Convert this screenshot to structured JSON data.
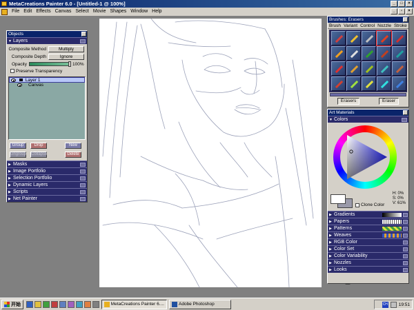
{
  "window": {
    "title": "MetaCreations Painter 6.0 - [Untitled-1 @ 100%]"
  },
  "menu": [
    "File",
    "Edit",
    "Effects",
    "Canvas",
    "Select",
    "Movie",
    "Shapes",
    "Window",
    "Help"
  ],
  "objects": {
    "title": "Objects",
    "layers_header": "Layers",
    "composite_method_label": "Composite Method",
    "composite_method_value": "Multiply",
    "composite_depth_label": "Composite Depth",
    "composite_depth_value": "Ignore",
    "opacity_label": "Opacity",
    "opacity_value": "100%",
    "opacity_fraction": 1.0,
    "preserve_transparency": "Preserve Transparency",
    "layers": [
      {
        "name": "Layer 1",
        "selected": true
      },
      {
        "name": "Canvas",
        "selected": false
      }
    ],
    "buttons": {
      "group": "Group",
      "drop": "Drop",
      "new": "New",
      "ungroup": "Ungroup",
      "collapse": "Collapse",
      "delete": "Delete"
    },
    "sections": [
      "Masks",
      "Image Portfolio",
      "Selection Portfolio",
      "Dynamic Layers",
      "Scripts",
      "Net Painter"
    ]
  },
  "brushes": {
    "title": "Brushes: Erasers",
    "tabs": [
      "Brush",
      "Variant",
      "Control",
      "Nozzle",
      "Stroke"
    ],
    "brush_name": "Erasers",
    "variant_name": "Eraser",
    "icons": [
      {
        "name": "pencil-brush-icon",
        "color": "#d04040"
      },
      {
        "name": "chalk-brush-icon",
        "color": "#f0c030"
      },
      {
        "name": "charcoal-brush-icon",
        "color": "#c0c0c0"
      },
      {
        "name": "eraser-brush-icon",
        "color": "#e04020"
      },
      {
        "name": "felt-pen-brush-icon",
        "color": "#d03030"
      },
      {
        "name": "airbrush-icon",
        "color": "#f0a020"
      },
      {
        "name": "image-hose-icon",
        "color": "#e0e0e0"
      },
      {
        "name": "crayon-brush-icon",
        "color": "#30a030"
      },
      {
        "name": "liquid-brush-icon",
        "color": "#c04020"
      },
      {
        "name": "oil-brush-icon",
        "color": "#20a0a0"
      },
      {
        "name": "watercolor-brush-icon",
        "color": "#e03030"
      },
      {
        "name": "pastel-brush-icon",
        "color": "#e0a030"
      },
      {
        "name": "cloner-brush-icon",
        "color": "#a0c020"
      },
      {
        "name": "artist-brush-icon",
        "color": "#40c0c0"
      },
      {
        "name": "plug-in-brush-icon",
        "color": "#c06040"
      },
      {
        "name": "pen-brush-icon",
        "color": "#d04030"
      },
      {
        "name": "dodge-brush-icon",
        "color": "#a0e040"
      },
      {
        "name": "burn-brush-icon",
        "color": "#e0e040"
      },
      {
        "name": "impasto-brush-icon",
        "color": "#30e0e0"
      },
      {
        "name": "wet-brush-icon",
        "color": "#4080e0"
      }
    ]
  },
  "artmat": {
    "title": "Art Materials",
    "colors_header": "Colors",
    "hsv": {
      "h": "H:  0%",
      "s": "S:  0%",
      "v": "V: 61%"
    },
    "clone_color": "Clone Color",
    "sections": [
      {
        "label": "Gradients",
        "preview": "gradient"
      },
      {
        "label": "Papers",
        "preview": "paper"
      },
      {
        "label": "Patterns",
        "preview": "pattern"
      },
      {
        "label": "Weaves",
        "preview": "weave"
      },
      {
        "label": "RGB Color",
        "preview": ""
      },
      {
        "label": "Color Set",
        "preview": ""
      },
      {
        "label": "Color Variability",
        "preview": ""
      },
      {
        "label": "Nozzles",
        "preview": ""
      },
      {
        "label": "Looks",
        "preview": ""
      }
    ]
  },
  "taskbar": {
    "start": "开始",
    "tasks": [
      {
        "label": "MetaCreations Painter 6....",
        "active": true
      },
      {
        "label": "Adobe Photoshop",
        "active": false
      }
    ],
    "clock": "19:51",
    "tray_text": "CH"
  }
}
